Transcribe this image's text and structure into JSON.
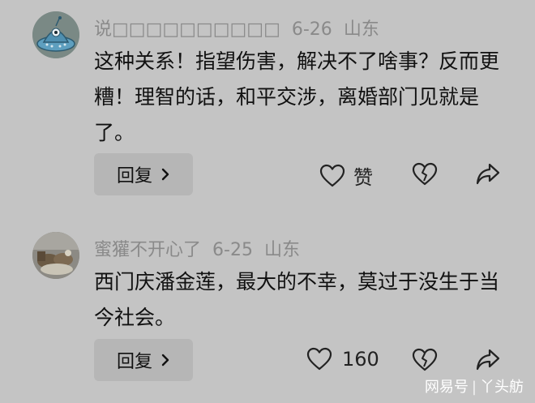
{
  "comments": [
    {
      "username": "说□□□□□□□□□□",
      "date": "6-26",
      "location": "山东",
      "text": "这种关系！指望伤害，解决不了啥事？反而更糟！理智的话，和平交涉，离婚部门见就是了。",
      "reply_label": "回复",
      "like_label": "赞",
      "avatar_icon": "alien-ufo-avatar"
    },
    {
      "username": "蜜獾不开心了",
      "date": "6-25",
      "location": "山东",
      "text": "西门庆潘金莲，最大的不幸，莫过于没生于当今社会。",
      "reply_label": "回复",
      "like_label": "160",
      "avatar_icon": "photo-avatar"
    }
  ],
  "watermark": {
    "left": "网易号",
    "right": "丫头舫"
  },
  "colors": {
    "background": "#c4c4c4",
    "meta_text": "#8a8a8a",
    "reply_bg": "#b6b6b6"
  }
}
